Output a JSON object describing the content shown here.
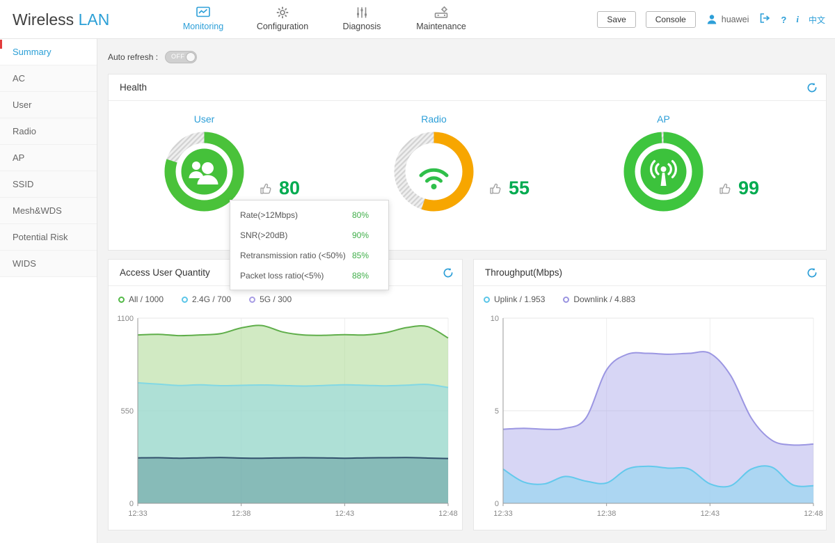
{
  "app": {
    "logo_primary": "Wireless",
    "logo_accent": "LAN"
  },
  "colors": {
    "accent_blue": "#2d9fd8",
    "score_green": "#00ab50",
    "ring_gray": "#e0e0e0"
  },
  "header": {
    "nav": [
      {
        "label": "Monitoring",
        "icon": "monitoring-icon",
        "active": true
      },
      {
        "label": "Configuration",
        "icon": "gear-icon",
        "active": false
      },
      {
        "label": "Diagnosis",
        "icon": "diagnosis-icon",
        "active": false
      },
      {
        "label": "Maintenance",
        "icon": "maintenance-icon",
        "active": false
      }
    ],
    "save_label": "Save",
    "console_label": "Console",
    "username": "huawei",
    "help_label": "?",
    "info_label": "i",
    "lang_label": "中文"
  },
  "sidebar": {
    "items": [
      "Summary",
      "AC",
      "User",
      "Radio",
      "AP",
      "SSID",
      "Mesh&WDS",
      "Potential Risk",
      "WIDS"
    ],
    "active": "Summary"
  },
  "toolbar": {
    "auto_refresh_label": "Auto refresh :",
    "auto_refresh_state": "OFF"
  },
  "health": {
    "title": "Health",
    "gauges": [
      {
        "label": "User",
        "score": 80,
        "ring_color": "#4ac23a"
      },
      {
        "label": "Radio",
        "score": 55,
        "ring_color": "#f7a600"
      },
      {
        "label": "AP",
        "score": 99,
        "ring_color": "#3ec53e"
      }
    ],
    "tooltip": {
      "rows": [
        {
          "label": "Rate(>12Mbps)",
          "value": "80%"
        },
        {
          "label": "SNR(>20dB)",
          "value": "90%"
        },
        {
          "label": "Retransmission ratio (<50%)",
          "value": "85%"
        },
        {
          "label": "Packet loss ratio(<5%)",
          "value": "88%"
        }
      ]
    }
  },
  "chart_data": [
    {
      "id": "access-user-quantity",
      "type": "area",
      "title": "Access User Quantity",
      "legend": [
        {
          "label": "All / 1000",
          "color": "#52b946"
        },
        {
          "label": "2.4G / 700",
          "color": "#5bc6e8"
        },
        {
          "label": "5G / 300",
          "color": "#a79ce4"
        }
      ],
      "x_ticks": [
        "12:33",
        "12:38",
        "12:43",
        "12:48"
      ],
      "ylim": [
        0,
        1100
      ],
      "y_ticks": [
        0,
        550,
        1100
      ],
      "grid": true,
      "series": [
        {
          "name": "All",
          "line": "#5fae4a",
          "fill": "rgba(172,216,146,0.55)",
          "values": [
            1000,
            1004,
            996,
            1000,
            1008,
            1042,
            1056,
            1018,
            1000,
            998,
            1002,
            1000,
            1014,
            1044,
            1050,
            982
          ]
        },
        {
          "name": "2.4G",
          "line": "#82d8e4",
          "fill": "rgba(150,216,226,0.60)",
          "values": [
            716,
            708,
            700,
            704,
            699,
            701,
            703,
            700,
            697,
            700,
            704,
            701,
            698,
            702,
            706,
            688
          ]
        },
        {
          "name": "5G",
          "line": "#31506b",
          "fill": "rgba(54,108,122,0.32)",
          "values": [
            270,
            271,
            268,
            270,
            272,
            269,
            268,
            270,
            271,
            270,
            268,
            270,
            271,
            272,
            269,
            266
          ]
        }
      ]
    },
    {
      "id": "throughput",
      "type": "area",
      "title": "Throughput(Mbps)",
      "legend": [
        {
          "label": "Uplink / 1.953",
          "color": "#5bc6e8"
        },
        {
          "label": "Downlink / 4.883",
          "color": "#9a94e0"
        }
      ],
      "x_ticks": [
        "12:33",
        "12:38",
        "12:43",
        "12:48"
      ],
      "ylim": [
        0,
        10
      ],
      "y_ticks": [
        0,
        5,
        10
      ],
      "grid": true,
      "series": [
        {
          "name": "Downlink",
          "line": "#9b96e2",
          "fill": "rgba(176,173,236,0.50)",
          "values": [
            4.0,
            4.05,
            4.0,
            4.05,
            4.6,
            7.2,
            8.05,
            8.1,
            8.05,
            8.1,
            8.1,
            6.9,
            4.6,
            3.4,
            3.15,
            3.2
          ]
        },
        {
          "name": "Uplink",
          "line": "#63c9ec",
          "fill": "rgba(146,214,240,0.62)",
          "values": [
            1.85,
            1.15,
            1.05,
            1.45,
            1.2,
            1.1,
            1.85,
            2.0,
            1.9,
            1.85,
            1.05,
            0.95,
            1.85,
            1.95,
            1.0,
            0.95
          ]
        }
      ]
    }
  ]
}
